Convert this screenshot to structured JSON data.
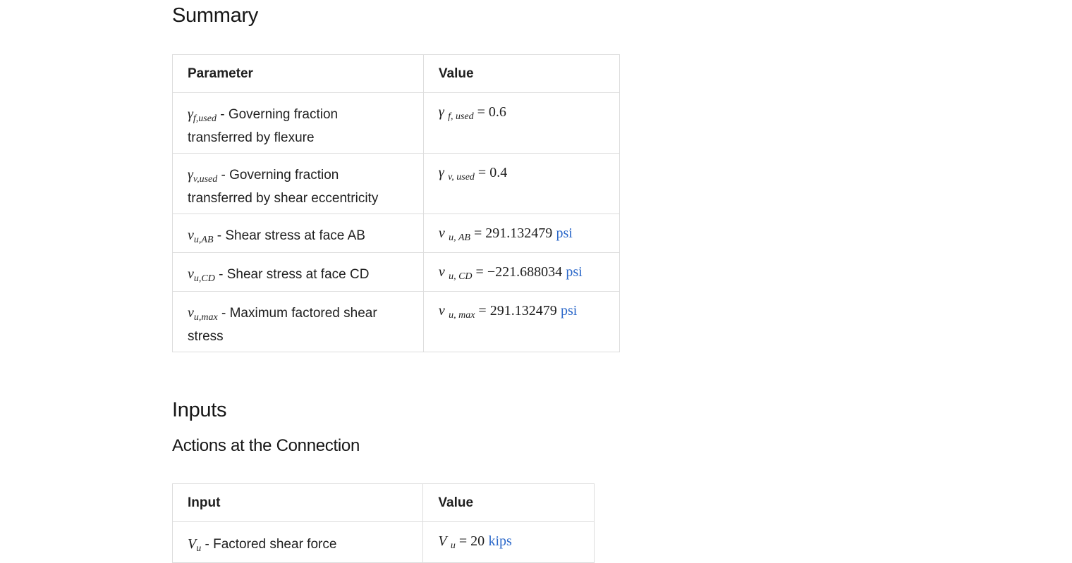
{
  "summary": {
    "heading": "Summary",
    "col_param": "Parameter",
    "col_value": "Value",
    "rows": [
      {
        "sym": "γ",
        "sub": "f,used",
        "desc": " - Governing fraction transferred by flexure",
        "vsym": "γ",
        "vsub": "f, used",
        "eq": " = ",
        "value": "0.6",
        "unit": ""
      },
      {
        "sym": "γ",
        "sub": "v,used",
        "desc": " - Governing fraction transferred by shear eccentricity",
        "vsym": "γ",
        "vsub": "v, used",
        "eq": " = ",
        "value": "0.4",
        "unit": ""
      },
      {
        "sym": "v",
        "sub": "u,AB",
        "desc": " - Shear stress at face AB",
        "vsym": "v",
        "vsub": "u, AB",
        "eq": " = ",
        "value": "291.132479",
        "unit": "psi"
      },
      {
        "sym": "v",
        "sub": "u,CD",
        "desc": " - Shear stress at face CD",
        "vsym": "v",
        "vsub": "u, CD",
        "eq": " = ",
        "value": "−221.688034",
        "unit": "psi"
      },
      {
        "sym": "v",
        "sub": "u,max",
        "desc": " - Maximum factored shear stress",
        "vsym": "v",
        "vsub": "u, max",
        "eq": " = ",
        "value": "291.132479",
        "unit": "psi"
      }
    ]
  },
  "inputs": {
    "heading": "Inputs",
    "subheading": "Actions at the Connection",
    "col_input": "Input",
    "col_value": "Value",
    "rows": [
      {
        "sym": "V",
        "sub": "u",
        "desc": " - Factored shear force",
        "vsym": "V",
        "vsub": "u",
        "eq": " = ",
        "value": "20",
        "unit": "kips"
      }
    ]
  }
}
